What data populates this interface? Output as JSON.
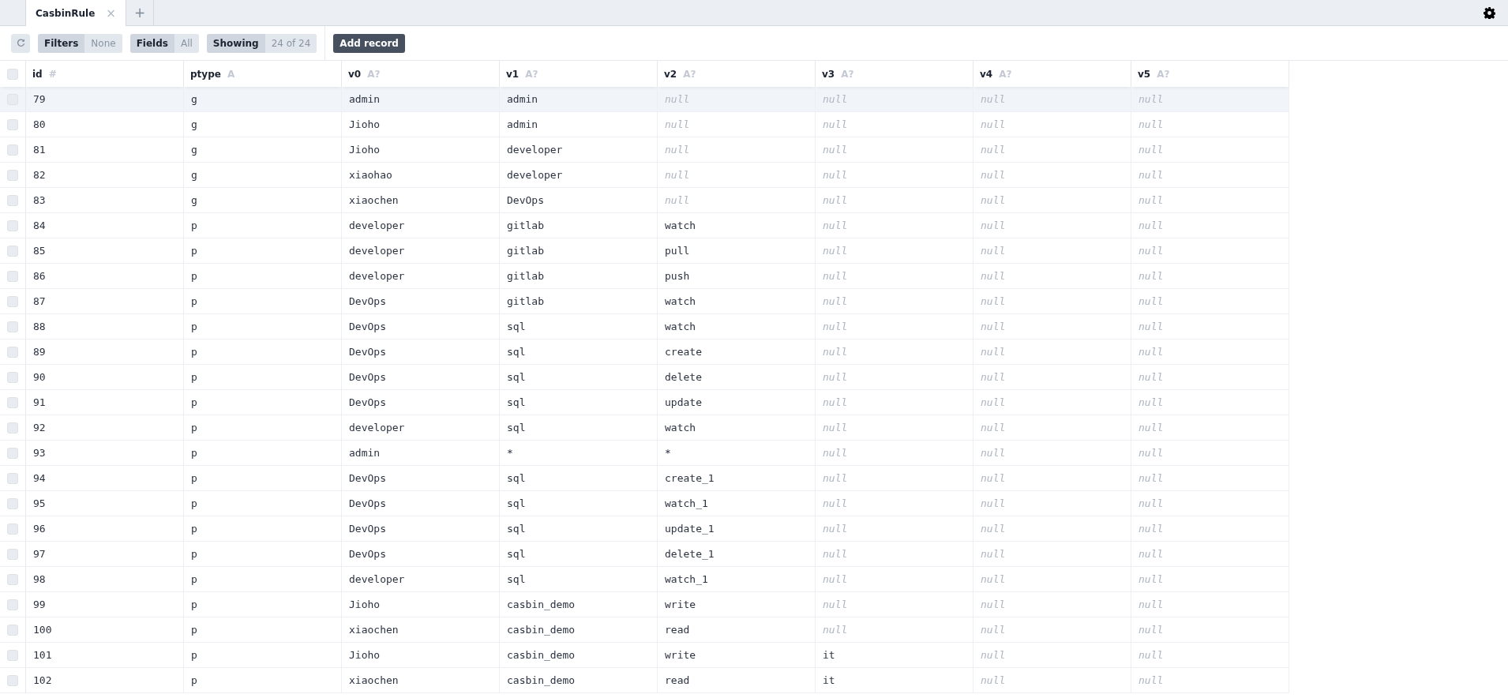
{
  "tabs": [
    {
      "label": "CasbinRule",
      "selected": true,
      "close": "×"
    }
  ],
  "new_tab": "+",
  "toolbar": {
    "filters": {
      "label": "Filters",
      "value": "None"
    },
    "fields": {
      "label": "Fields",
      "value": "All"
    },
    "showing": {
      "label": "Showing",
      "value": "24 of 24"
    },
    "add_record": "Add record"
  },
  "table": {
    "select_all": {
      "checked": false
    },
    "columns": [
      {
        "name": "id",
        "type": "#"
      },
      {
        "name": "ptype",
        "type": "A"
      },
      {
        "name": "v0",
        "type": "A?"
      },
      {
        "name": "v1",
        "type": "A?"
      },
      {
        "name": "v2",
        "type": "A?"
      },
      {
        "name": "v3",
        "type": "A?"
      },
      {
        "name": "v4",
        "type": "A?"
      },
      {
        "name": "v5",
        "type": "A?"
      }
    ],
    "rows": [
      {
        "checked": false,
        "hovered": true,
        "cells": [
          {
            "text": "79"
          },
          {
            "text": "g"
          },
          {
            "text": "admin"
          },
          {
            "text": "admin"
          },
          {
            "text": "null",
            "kind": "null"
          },
          {
            "text": "null",
            "kind": "null"
          },
          {
            "text": "null",
            "kind": "null"
          },
          {
            "text": "null",
            "kind": "null"
          }
        ]
      },
      {
        "checked": false,
        "hovered": false,
        "cells": [
          {
            "text": "80"
          },
          {
            "text": "g"
          },
          {
            "text": "Jioho"
          },
          {
            "text": "admin"
          },
          {
            "text": "null",
            "kind": "null"
          },
          {
            "text": "null",
            "kind": "null"
          },
          {
            "text": "null",
            "kind": "null"
          },
          {
            "text": "null",
            "kind": "null"
          }
        ]
      },
      {
        "checked": false,
        "hovered": false,
        "cells": [
          {
            "text": "81"
          },
          {
            "text": "g"
          },
          {
            "text": "Jioho"
          },
          {
            "text": "developer"
          },
          {
            "text": "null",
            "kind": "null"
          },
          {
            "text": "null",
            "kind": "null"
          },
          {
            "text": "null",
            "kind": "null"
          },
          {
            "text": "null",
            "kind": "null"
          }
        ]
      },
      {
        "checked": false,
        "hovered": false,
        "cells": [
          {
            "text": "82"
          },
          {
            "text": "g"
          },
          {
            "text": "xiaohao"
          },
          {
            "text": "developer"
          },
          {
            "text": "null",
            "kind": "null"
          },
          {
            "text": "null",
            "kind": "null"
          },
          {
            "text": "null",
            "kind": "null"
          },
          {
            "text": "null",
            "kind": "null"
          }
        ]
      },
      {
        "checked": false,
        "hovered": false,
        "cells": [
          {
            "text": "83"
          },
          {
            "text": "g"
          },
          {
            "text": "xiaochen"
          },
          {
            "text": "DevOps"
          },
          {
            "text": "null",
            "kind": "null"
          },
          {
            "text": "null",
            "kind": "null"
          },
          {
            "text": "null",
            "kind": "null"
          },
          {
            "text": "null",
            "kind": "null"
          }
        ]
      },
      {
        "checked": false,
        "hovered": false,
        "cells": [
          {
            "text": "84"
          },
          {
            "text": "p"
          },
          {
            "text": "developer"
          },
          {
            "text": "gitlab"
          },
          {
            "text": "watch"
          },
          {
            "text": "null",
            "kind": "null"
          },
          {
            "text": "null",
            "kind": "null"
          },
          {
            "text": "null",
            "kind": "null"
          }
        ]
      },
      {
        "checked": false,
        "hovered": false,
        "cells": [
          {
            "text": "85"
          },
          {
            "text": "p"
          },
          {
            "text": "developer"
          },
          {
            "text": "gitlab"
          },
          {
            "text": "pull"
          },
          {
            "text": "null",
            "kind": "null"
          },
          {
            "text": "null",
            "kind": "null"
          },
          {
            "text": "null",
            "kind": "null"
          }
        ]
      },
      {
        "checked": false,
        "hovered": false,
        "cells": [
          {
            "text": "86"
          },
          {
            "text": "p"
          },
          {
            "text": "developer"
          },
          {
            "text": "gitlab"
          },
          {
            "text": "push"
          },
          {
            "text": "null",
            "kind": "null"
          },
          {
            "text": "null",
            "kind": "null"
          },
          {
            "text": "null",
            "kind": "null"
          }
        ]
      },
      {
        "checked": false,
        "hovered": false,
        "cells": [
          {
            "text": "87"
          },
          {
            "text": "p"
          },
          {
            "text": "DevOps"
          },
          {
            "text": "gitlab"
          },
          {
            "text": "watch"
          },
          {
            "text": "null",
            "kind": "null"
          },
          {
            "text": "null",
            "kind": "null"
          },
          {
            "text": "null",
            "kind": "null"
          }
        ]
      },
      {
        "checked": false,
        "hovered": false,
        "cells": [
          {
            "text": "88"
          },
          {
            "text": "p"
          },
          {
            "text": "DevOps"
          },
          {
            "text": "sql"
          },
          {
            "text": "watch"
          },
          {
            "text": "null",
            "kind": "null"
          },
          {
            "text": "null",
            "kind": "null"
          },
          {
            "text": "null",
            "kind": "null"
          }
        ]
      },
      {
        "checked": false,
        "hovered": false,
        "cells": [
          {
            "text": "89"
          },
          {
            "text": "p"
          },
          {
            "text": "DevOps"
          },
          {
            "text": "sql"
          },
          {
            "text": "create"
          },
          {
            "text": "null",
            "kind": "null"
          },
          {
            "text": "null",
            "kind": "null"
          },
          {
            "text": "null",
            "kind": "null"
          }
        ]
      },
      {
        "checked": false,
        "hovered": false,
        "cells": [
          {
            "text": "90"
          },
          {
            "text": "p"
          },
          {
            "text": "DevOps"
          },
          {
            "text": "sql"
          },
          {
            "text": "delete"
          },
          {
            "text": "null",
            "kind": "null"
          },
          {
            "text": "null",
            "kind": "null"
          },
          {
            "text": "null",
            "kind": "null"
          }
        ]
      },
      {
        "checked": false,
        "hovered": false,
        "cells": [
          {
            "text": "91"
          },
          {
            "text": "p"
          },
          {
            "text": "DevOps"
          },
          {
            "text": "sql"
          },
          {
            "text": "update"
          },
          {
            "text": "null",
            "kind": "null"
          },
          {
            "text": "null",
            "kind": "null"
          },
          {
            "text": "null",
            "kind": "null"
          }
        ]
      },
      {
        "checked": false,
        "hovered": false,
        "cells": [
          {
            "text": "92"
          },
          {
            "text": "p"
          },
          {
            "text": "developer"
          },
          {
            "text": "sql"
          },
          {
            "text": "watch"
          },
          {
            "text": "null",
            "kind": "null"
          },
          {
            "text": "null",
            "kind": "null"
          },
          {
            "text": "null",
            "kind": "null"
          }
        ]
      },
      {
        "checked": false,
        "hovered": false,
        "cells": [
          {
            "text": "93"
          },
          {
            "text": "p"
          },
          {
            "text": "admin"
          },
          {
            "text": "*"
          },
          {
            "text": "*"
          },
          {
            "text": "null",
            "kind": "null"
          },
          {
            "text": "null",
            "kind": "null"
          },
          {
            "text": "null",
            "kind": "null"
          }
        ]
      },
      {
        "checked": false,
        "hovered": false,
        "cells": [
          {
            "text": "94"
          },
          {
            "text": "p"
          },
          {
            "text": "DevOps"
          },
          {
            "text": "sql"
          },
          {
            "text": "create_1"
          },
          {
            "text": "null",
            "kind": "null"
          },
          {
            "text": "null",
            "kind": "null"
          },
          {
            "text": "null",
            "kind": "null"
          }
        ]
      },
      {
        "checked": false,
        "hovered": false,
        "cells": [
          {
            "text": "95"
          },
          {
            "text": "p"
          },
          {
            "text": "DevOps"
          },
          {
            "text": "sql"
          },
          {
            "text": "watch_1"
          },
          {
            "text": "null",
            "kind": "null"
          },
          {
            "text": "null",
            "kind": "null"
          },
          {
            "text": "null",
            "kind": "null"
          }
        ]
      },
      {
        "checked": false,
        "hovered": false,
        "cells": [
          {
            "text": "96"
          },
          {
            "text": "p"
          },
          {
            "text": "DevOps"
          },
          {
            "text": "sql"
          },
          {
            "text": "update_1"
          },
          {
            "text": "null",
            "kind": "null"
          },
          {
            "text": "null",
            "kind": "null"
          },
          {
            "text": "null",
            "kind": "null"
          }
        ]
      },
      {
        "checked": false,
        "hovered": false,
        "cells": [
          {
            "text": "97"
          },
          {
            "text": "p"
          },
          {
            "text": "DevOps"
          },
          {
            "text": "sql"
          },
          {
            "text": "delete_1"
          },
          {
            "text": "null",
            "kind": "null"
          },
          {
            "text": "null",
            "kind": "null"
          },
          {
            "text": "null",
            "kind": "null"
          }
        ]
      },
      {
        "checked": false,
        "hovered": false,
        "cells": [
          {
            "text": "98"
          },
          {
            "text": "p"
          },
          {
            "text": "developer"
          },
          {
            "text": "sql"
          },
          {
            "text": "watch_1"
          },
          {
            "text": "null",
            "kind": "null"
          },
          {
            "text": "null",
            "kind": "null"
          },
          {
            "text": "null",
            "kind": "null"
          }
        ]
      },
      {
        "checked": false,
        "hovered": false,
        "cells": [
          {
            "text": "99"
          },
          {
            "text": "p"
          },
          {
            "text": "Jioho"
          },
          {
            "text": "casbin_demo"
          },
          {
            "text": "write"
          },
          {
            "text": "null",
            "kind": "null"
          },
          {
            "text": "null",
            "kind": "null"
          },
          {
            "text": "null",
            "kind": "null"
          }
        ]
      },
      {
        "checked": false,
        "hovered": false,
        "cells": [
          {
            "text": "100"
          },
          {
            "text": "p"
          },
          {
            "text": "xiaochen"
          },
          {
            "text": "casbin_demo"
          },
          {
            "text": "read"
          },
          {
            "text": "null",
            "kind": "null"
          },
          {
            "text": "null",
            "kind": "null"
          },
          {
            "text": "null",
            "kind": "null"
          }
        ]
      },
      {
        "checked": false,
        "hovered": false,
        "cells": [
          {
            "text": "101"
          },
          {
            "text": "p"
          },
          {
            "text": "Jioho"
          },
          {
            "text": "casbin_demo"
          },
          {
            "text": "write"
          },
          {
            "text": "it"
          },
          {
            "text": "null",
            "kind": "null"
          },
          {
            "text": "null",
            "kind": "null"
          }
        ]
      },
      {
        "checked": false,
        "hovered": false,
        "cells": [
          {
            "text": "102"
          },
          {
            "text": "p"
          },
          {
            "text": "xiaochen"
          },
          {
            "text": "casbin_demo"
          },
          {
            "text": "read"
          },
          {
            "text": "it"
          },
          {
            "text": "null",
            "kind": "null"
          },
          {
            "text": "null",
            "kind": "null"
          }
        ]
      }
    ]
  }
}
